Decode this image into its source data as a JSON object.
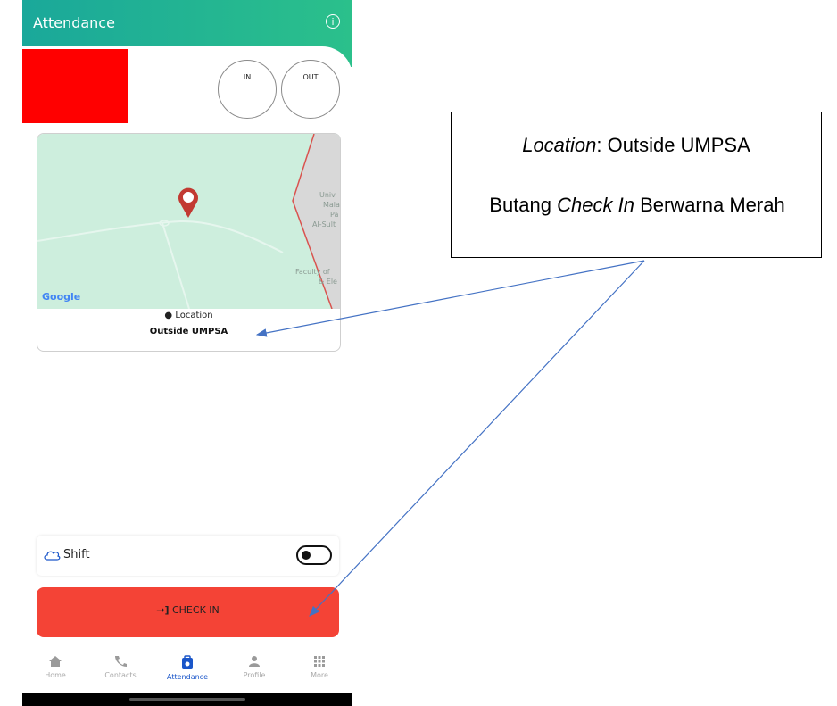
{
  "header": {
    "title": "Attendance",
    "info_icon": "info-icon"
  },
  "punch_buttons": {
    "in_label": "IN",
    "out_label": "OUT"
  },
  "map": {
    "map_labels": [
      "Univ",
      "Mala",
      "Pa",
      "Al-Sult",
      "Faculty of",
      "& Ele"
    ],
    "google_logo": "Google",
    "location_label": "Location",
    "location_value": "Outside UMPSA"
  },
  "shift": {
    "label": "Shift",
    "toggle_on": false
  },
  "check_in": {
    "label": "CHECK IN",
    "color": "#f44336"
  },
  "bottom_nav": {
    "items": [
      {
        "label": "Home",
        "icon": "home-icon"
      },
      {
        "label": "Contacts",
        "icon": "phone-icon"
      },
      {
        "label": "Attendance",
        "icon": "attendance-icon",
        "active": true
      },
      {
        "label": "Profile",
        "icon": "profile-icon"
      },
      {
        "label": "More",
        "icon": "grid-icon"
      }
    ]
  },
  "annotation": {
    "location_prefix": "Location",
    "location_suffix": ": Outside UMPSA",
    "line2_a": "Butang ",
    "line2_b": "Check In",
    "line2_c": " Berwarna Merah"
  },
  "colors": {
    "header_start": "#1aa89a",
    "header_end": "#2bc08b",
    "accent": "#1a56c9",
    "arrow": "#4472c4"
  }
}
